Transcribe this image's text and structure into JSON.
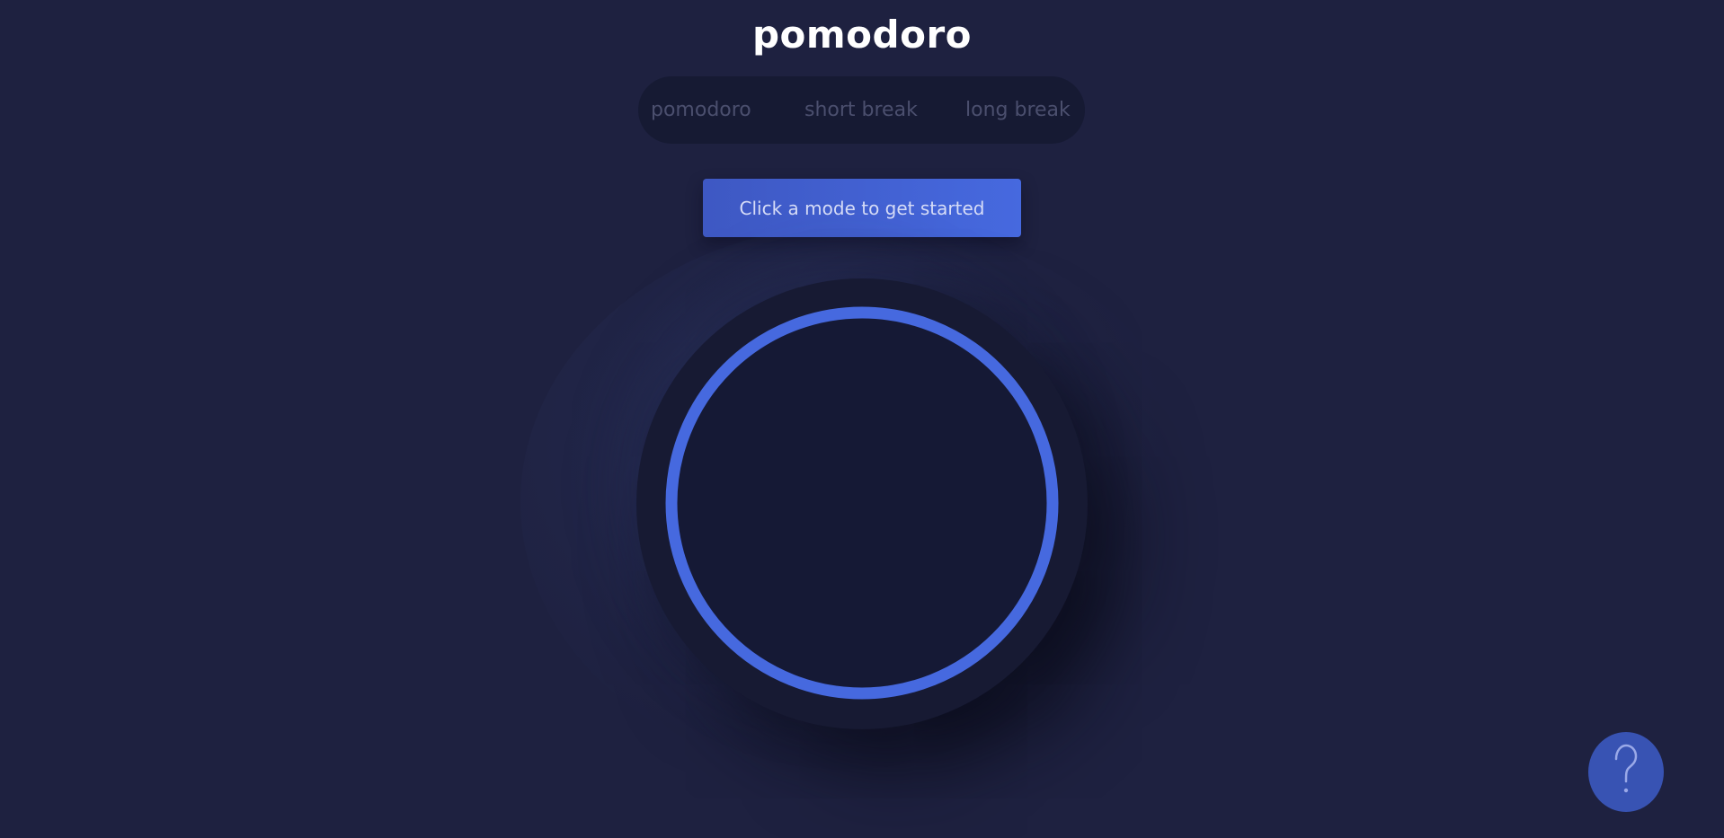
{
  "header": {
    "title": "pomodoro"
  },
  "modes": {
    "tabs": [
      {
        "label": "pomodoro"
      },
      {
        "label": "short break"
      },
      {
        "label": "long break"
      }
    ]
  },
  "main": {
    "start_label": "Click a mode to get started"
  },
  "timer": {
    "progress": 1.0,
    "ring_color": "#4669df"
  },
  "help": {
    "icon": "question-mark-icon"
  },
  "colors": {
    "background": "#1e2140",
    "accent": "#4669df",
    "panel": "#161a33",
    "muted_text": "#4b4f6e"
  }
}
